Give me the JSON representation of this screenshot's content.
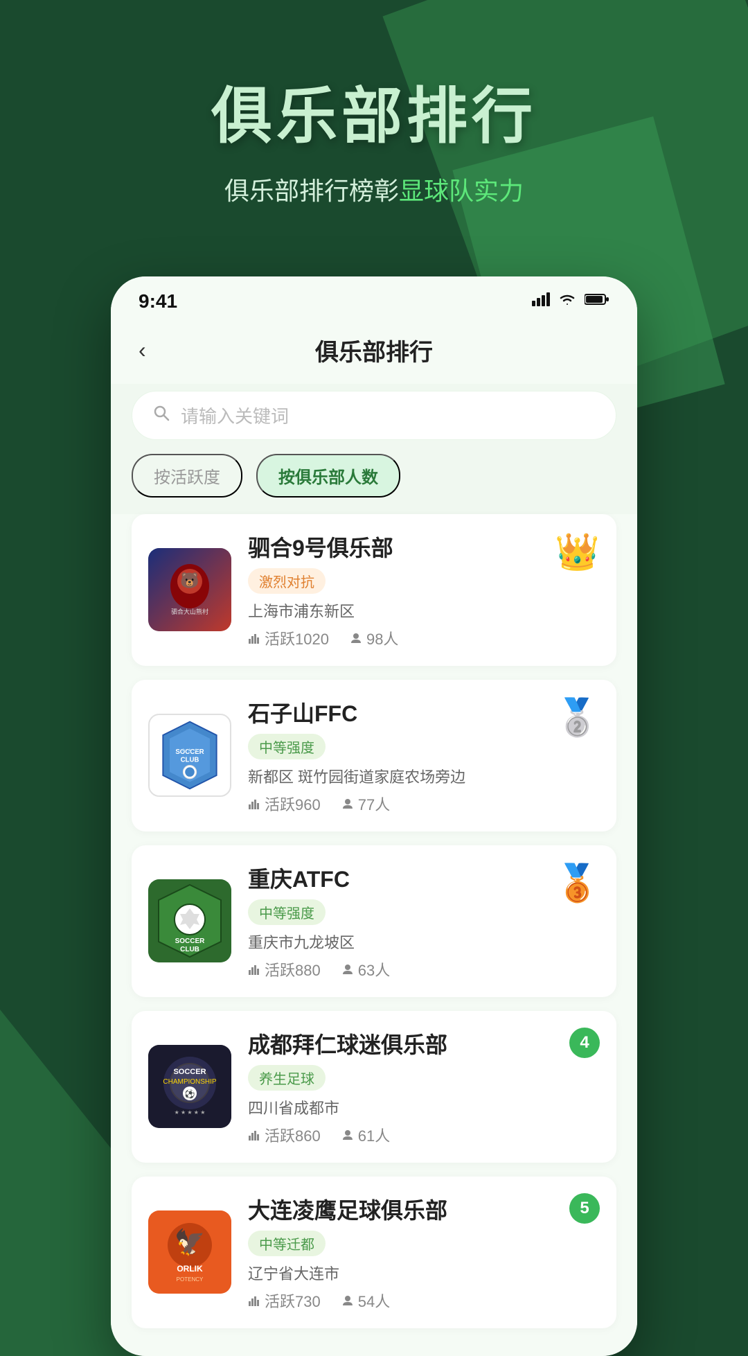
{
  "hero": {
    "title": "俱乐部排行",
    "subtitle_prefix": "俱乐部排行榜彰",
    "subtitle_highlight": "显球队实力",
    "highlight_color": "#5de87a"
  },
  "status_bar": {
    "time": "9:41",
    "signal": "📶",
    "wifi": "WiFi",
    "battery": "🔋"
  },
  "app": {
    "title": "俱乐部排行",
    "back_label": "‹"
  },
  "search": {
    "placeholder": "请输入关键词"
  },
  "filters": [
    {
      "id": "activity",
      "label": "按活跃度",
      "active": false
    },
    {
      "id": "members",
      "label": "按俱乐部人数",
      "active": true
    }
  ],
  "clubs": [
    {
      "rank": 1,
      "rank_type": "gold",
      "name": "驷合9号俱乐部",
      "tag": "激烈对抗",
      "location": "上海市浦东新区",
      "activity": "活跃1020",
      "members": "98人",
      "logo_type": "bear"
    },
    {
      "rank": 2,
      "rank_type": "silver",
      "name": "石子山FFC",
      "tag": "中等强度",
      "location": "新都区 斑竹园街道家庭农场旁边",
      "activity": "活跃960",
      "members": "77人",
      "logo_type": "soccer_club_blue"
    },
    {
      "rank": 3,
      "rank_type": "bronze",
      "name": "重庆ATFC",
      "tag": "中等强度",
      "location": "重庆市九龙坡区",
      "activity": "活跃880",
      "members": "63人",
      "logo_type": "soccer_club_green"
    },
    {
      "rank": 4,
      "rank_type": "number",
      "name": "成都拜仁球迷俱乐部",
      "tag": "养生足球",
      "location": "四川省成都市",
      "activity": "活跃860",
      "members": "61人",
      "logo_type": "soccer_championship"
    },
    {
      "rank": 5,
      "rank_type": "number",
      "name": "大连凌鹰足球俱乐部",
      "tag": "中等迁都",
      "location": "辽宁省大连市",
      "activity": "活跃730",
      "members": "54人",
      "logo_type": "orlik"
    }
  ]
}
